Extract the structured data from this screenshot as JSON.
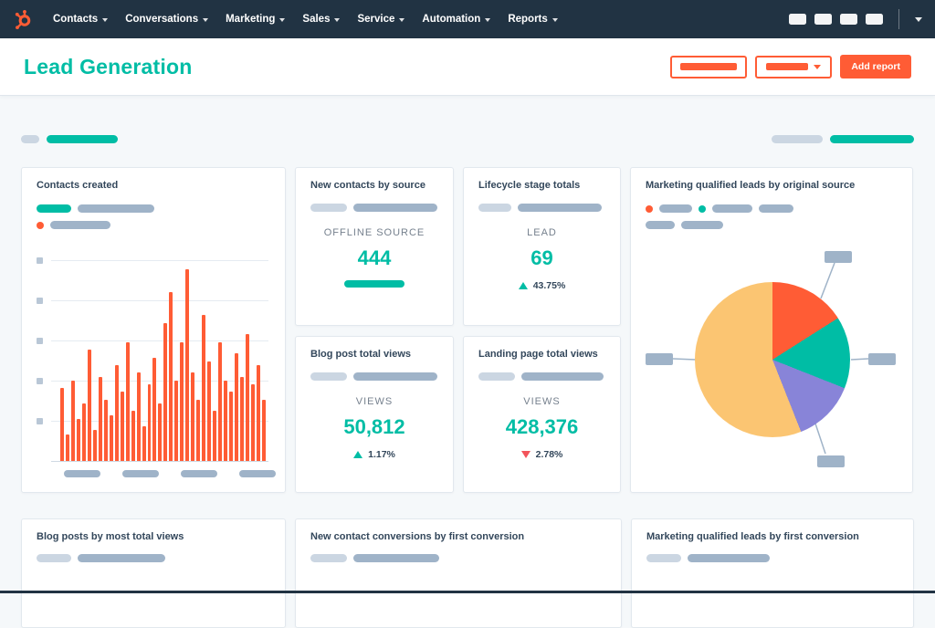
{
  "nav": {
    "items": [
      {
        "label": "Contacts"
      },
      {
        "label": "Conversations"
      },
      {
        "label": "Marketing"
      },
      {
        "label": "Sales"
      },
      {
        "label": "Service"
      },
      {
        "label": "Automation"
      },
      {
        "label": "Reports"
      }
    ]
  },
  "header": {
    "title": "Lead Generation",
    "add_report": "Add report"
  },
  "cards": {
    "contacts_created": {
      "title": "Contacts created"
    },
    "new_contacts_by_source": {
      "title": "New contacts by source",
      "label": "OFFLINE SOURCE",
      "value": "444"
    },
    "lifecycle_stage_totals": {
      "title": "Lifecycle stage totals",
      "label": "LEAD",
      "value": "69",
      "delta": "43.75%",
      "direction": "up"
    },
    "mql_original_source": {
      "title": "Marketing qualified leads by original source"
    },
    "blog_post_total_views": {
      "title": "Blog post total views",
      "label": "VIEWS",
      "value": "50,812",
      "delta": "1.17%",
      "direction": "up"
    },
    "landing_page_total_views": {
      "title": "Landing page total views",
      "label": "VIEWS",
      "value": "428,376",
      "delta": "2.78%",
      "direction": "down"
    },
    "blog_posts_most_views": {
      "title": "Blog posts by most total views"
    },
    "new_contact_conversions": {
      "title": "New contact conversions by first conversion"
    },
    "mql_first_conversion": {
      "title": "Marketing qualified leads by first conversion"
    }
  },
  "colors": {
    "navy": "#213343",
    "orange": "#ff5c35",
    "teal": "#00bda5",
    "red": "#f2545b",
    "purple": "#8884d8",
    "sand": "#fbc572",
    "placeholder_gray": "#9fb3c8",
    "placeholder_light": "#cbd6e2"
  },
  "chart_data": [
    {
      "type": "bar",
      "title": "Contacts created",
      "color": "#ff5c35",
      "values": [
        38,
        14,
        42,
        22,
        30,
        58,
        16,
        44,
        32,
        24,
        50,
        36,
        62,
        26,
        46,
        18,
        40,
        54,
        30,
        72,
        88,
        42,
        62,
        100,
        46,
        32,
        76,
        52,
        26,
        62,
        42,
        36,
        56,
        44,
        66,
        40,
        50,
        32
      ],
      "ylim": [
        0,
        100
      ],
      "grid": true,
      "axis_labels_redacted": true
    },
    {
      "type": "pie",
      "title": "Marketing qualified leads by original source",
      "slices": [
        {
          "value": 16,
          "color": "#ff5c35"
        },
        {
          "value": 15,
          "color": "#00bda5"
        },
        {
          "value": 13,
          "color": "#8884d8"
        },
        {
          "value": 56,
          "color": "#fbc572"
        }
      ],
      "labels_redacted": true
    }
  ]
}
